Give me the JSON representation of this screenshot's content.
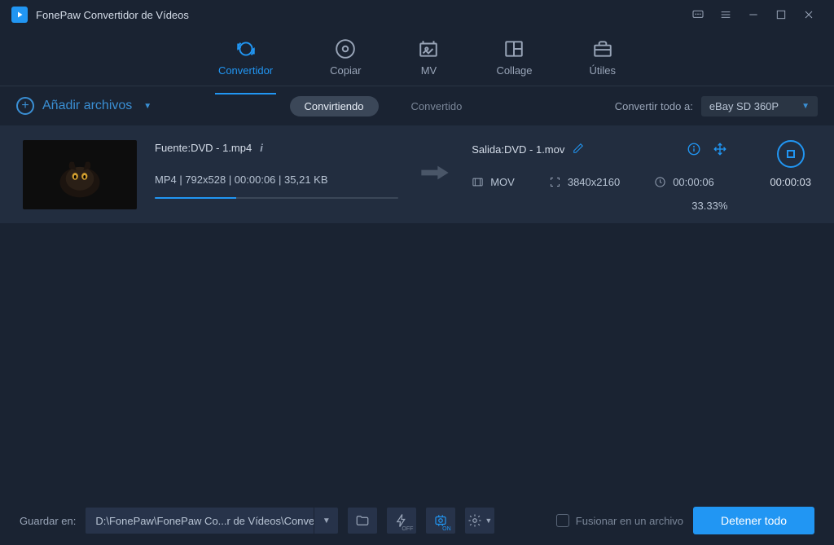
{
  "app": {
    "title": "FonePaw Convertidor de Vídeos"
  },
  "nav": {
    "convertidor": "Convertidor",
    "copiar": "Copiar",
    "mv": "MV",
    "collage": "Collage",
    "utiles": "Útiles"
  },
  "toolbar": {
    "add_files": "Añadir archivos",
    "converting": "Convirtiendo",
    "converted": "Convertido",
    "convert_all_to": "Convertir todo a:",
    "preset": "eBay SD 360P"
  },
  "item": {
    "source_label": "Fuente:",
    "source_name": "DVD - 1.mp4",
    "source_meta": "MP4 | 792x528 | 00:00:06 | 35,21 KB",
    "output_label": "Salida:",
    "output_name": "DVD - 1.mov",
    "out_format": "MOV",
    "out_res": "3840x2160",
    "out_dur": "00:00:06",
    "percent": "33.33%",
    "elapsed": "00:00:03"
  },
  "bottom": {
    "save_to": "Guardar en:",
    "path": "D:\\FonePaw\\FonePaw Co...r de Vídeos\\Converted",
    "merge": "Fusionar en un archivo",
    "stop_all": "Detener todo"
  }
}
